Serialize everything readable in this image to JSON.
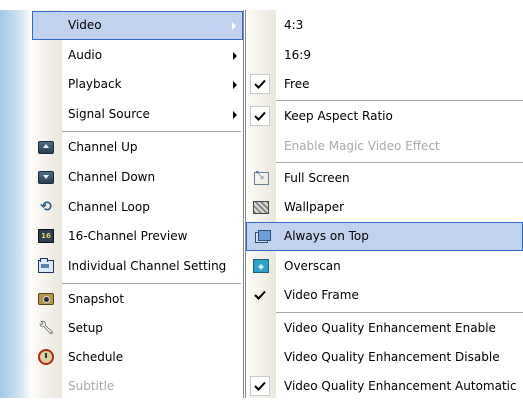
{
  "main_menu": {
    "items": [
      {
        "label": "Video",
        "icon": "",
        "submenu": true,
        "highlighted": true
      },
      {
        "label": "Audio",
        "icon": "",
        "submenu": true
      },
      {
        "label": "Playback",
        "icon": "",
        "submenu": true
      },
      {
        "label": "Signal Source",
        "icon": "",
        "submenu": true
      },
      {
        "label": "Channel Up",
        "icon": "channel-up-icon"
      },
      {
        "label": "Channel Down",
        "icon": "channel-down-icon"
      },
      {
        "label": "Channel Loop",
        "icon": "channel-loop-icon"
      },
      {
        "label": "16-Channel Preview",
        "icon": "sixteen-channel-preview-icon",
        "icon_text": "16"
      },
      {
        "label": "Individual Channel Setting",
        "icon": "channel-setting-icon"
      },
      {
        "label": "Snapshot",
        "icon": "snapshot-icon"
      },
      {
        "label": "Setup",
        "icon": "setup-icon"
      },
      {
        "label": "Schedule",
        "icon": "schedule-icon"
      },
      {
        "label": "Subtitle",
        "icon": "",
        "disabled": true
      }
    ]
  },
  "video_submenu": {
    "items": [
      {
        "label": "4:3",
        "checked": false
      },
      {
        "label": "16:9",
        "checked": false
      },
      {
        "label": "Free",
        "checked": true
      },
      {
        "label": "Keep Aspect Ratio",
        "checked": true
      },
      {
        "label": "Enable Magic Video Effect",
        "disabled": true
      },
      {
        "label": "Full Screen",
        "icon": "full-screen-icon"
      },
      {
        "label": "Wallpaper",
        "icon": "wallpaper-icon"
      },
      {
        "label": "Always on Top",
        "icon": "always-on-top-icon",
        "highlighted": true
      },
      {
        "label": "Overscan",
        "icon": "overscan-icon"
      },
      {
        "label": "Video Frame",
        "checked": true
      },
      {
        "label": "Video Quality Enhancement Enable",
        "checked": false
      },
      {
        "label": "Video Quality Enhancement Disable",
        "checked": false
      },
      {
        "label": "Video Quality Enhancement Automatic",
        "checked": true
      }
    ]
  },
  "colors": {
    "highlight_bg": "#c1d2ee",
    "highlight_border": "#316ac5",
    "disabled_text": "#a9a9a9",
    "left_strip": "#9cc8e8"
  }
}
